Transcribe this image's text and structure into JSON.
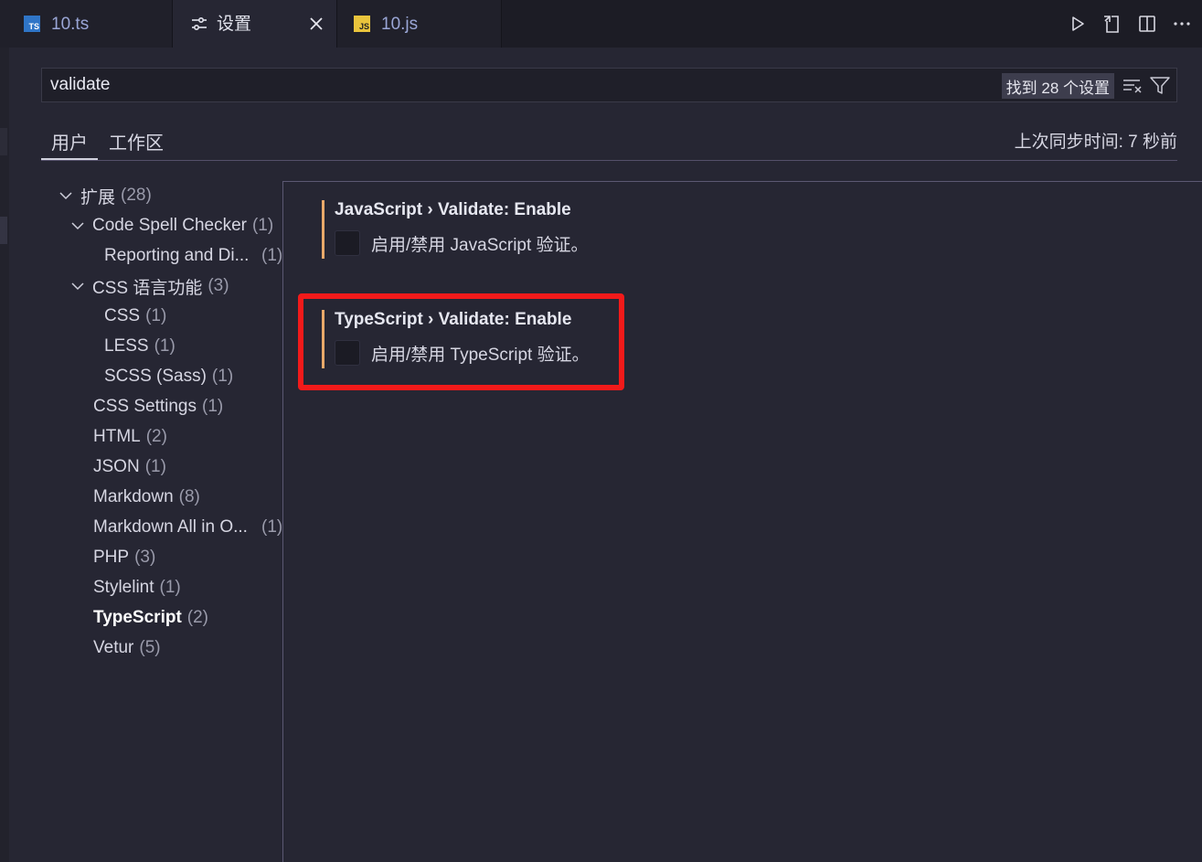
{
  "tabs": {
    "ts": {
      "badge": "TS",
      "label": "10.ts"
    },
    "settings": {
      "label": "设置"
    },
    "js": {
      "badge": "JS",
      "label": "10.js"
    }
  },
  "search": {
    "value": "validate",
    "result_count": "找到 28 个设置"
  },
  "scope": {
    "user": "用户",
    "workspace": "工作区",
    "sync_status": "上次同步时间: 7 秒前"
  },
  "toc": [
    {
      "label": "扩展",
      "count": "(28)"
    },
    {
      "label": "Code Spell Checker",
      "count": "(1)"
    },
    {
      "label": "Reporting and Di...",
      "count": "(1)"
    },
    {
      "label": "CSS 语言功能",
      "count": "(3)"
    },
    {
      "label": "CSS",
      "count": "(1)"
    },
    {
      "label": "LESS",
      "count": "(1)"
    },
    {
      "label": "SCSS (Sass)",
      "count": "(1)"
    },
    {
      "label": "CSS Settings",
      "count": "(1)"
    },
    {
      "label": "HTML",
      "count": "(2)"
    },
    {
      "label": "JSON",
      "count": "(1)"
    },
    {
      "label": "Markdown",
      "count": "(8)"
    },
    {
      "label": "Markdown All in O...",
      "count": "(1)"
    },
    {
      "label": "PHP",
      "count": "(3)"
    },
    {
      "label": "Stylelint",
      "count": "(1)"
    },
    {
      "label": "TypeScript",
      "count": "(2)"
    },
    {
      "label": "Vetur",
      "count": "(5)"
    }
  ],
  "settings": [
    {
      "category": "JavaScript › Validate: ",
      "name": "Enable",
      "description": "启用/禁用 JavaScript 验证。",
      "checked": false
    },
    {
      "category": "TypeScript › Validate: ",
      "name": "Enable",
      "description": "启用/禁用 TypeScript 验证。",
      "checked": false
    }
  ],
  "colors": {
    "highlight": "#f21a1a",
    "modified_bar": "#e9a96a",
    "background": "#262633"
  }
}
